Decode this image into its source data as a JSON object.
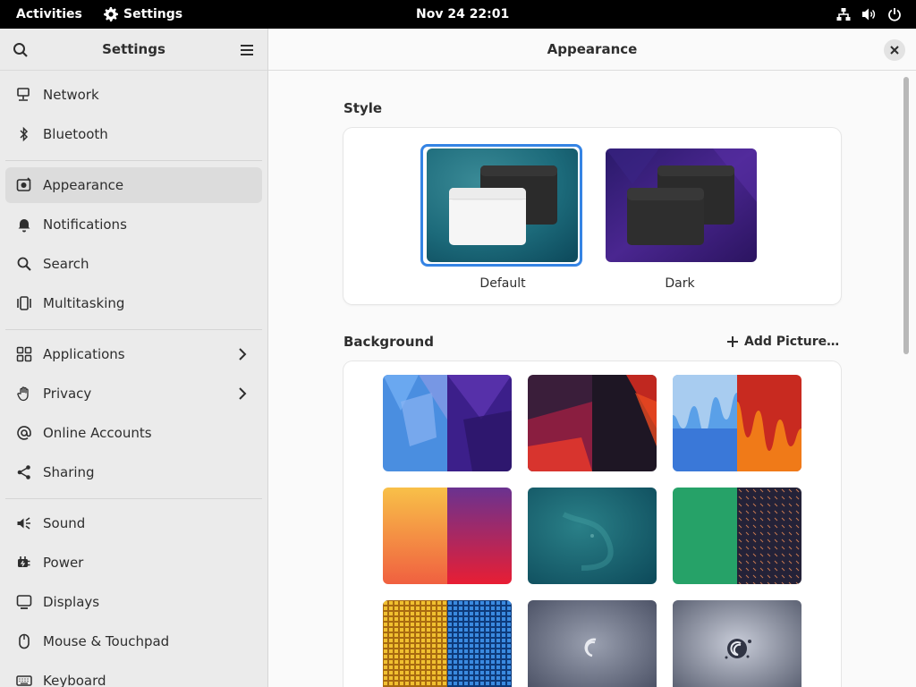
{
  "topbar": {
    "activities": "Activities",
    "app_name": "Settings",
    "clock": "Nov 24  22:01",
    "status_icons": [
      "network-wired-icon",
      "volume-icon",
      "power-icon"
    ]
  },
  "sidebar": {
    "title": "Settings",
    "items": [
      {
        "label": "Network",
        "icon": "network-icon"
      },
      {
        "label": "Bluetooth",
        "icon": "bluetooth-icon"
      },
      {
        "label": "Appearance",
        "icon": "appearance-icon",
        "active": true
      },
      {
        "label": "Notifications",
        "icon": "bell-icon"
      },
      {
        "label": "Search",
        "icon": "search-icon"
      },
      {
        "label": "Multitasking",
        "icon": "multitasking-icon"
      },
      {
        "label": "Applications",
        "icon": "grid-icon",
        "has_submenu": true
      },
      {
        "label": "Privacy",
        "icon": "hand-icon",
        "has_submenu": true
      },
      {
        "label": "Online Accounts",
        "icon": "at-icon"
      },
      {
        "label": "Sharing",
        "icon": "share-icon"
      },
      {
        "label": "Sound",
        "icon": "speaker-icon"
      },
      {
        "label": "Power",
        "icon": "power-plug-icon"
      },
      {
        "label": "Displays",
        "icon": "display-icon"
      },
      {
        "label": "Mouse & Touchpad",
        "icon": "mouse-icon"
      },
      {
        "label": "Keyboard",
        "icon": "keyboard-icon"
      }
    ]
  },
  "main": {
    "title": "Appearance",
    "style": {
      "title": "Style",
      "options": [
        {
          "label": "Default",
          "selected": true
        },
        {
          "label": "Dark",
          "selected": false
        }
      ]
    },
    "background": {
      "title": "Background",
      "add_label": "Add Picture…"
    }
  },
  "colors": {
    "accent": "#3584e4",
    "topbar": "#000000",
    "sidebar": "#ebebeb"
  }
}
